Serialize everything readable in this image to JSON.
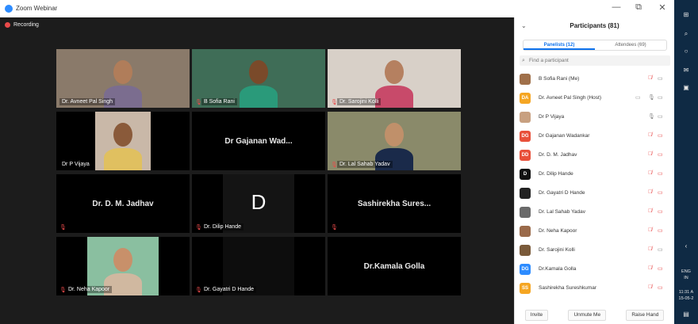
{
  "window": {
    "title": "Zoom Webinar",
    "min": "—",
    "restore": "⧉",
    "close": "✕"
  },
  "recording": {
    "label": "Recording"
  },
  "tiles": [
    {
      "kind": "video",
      "name": "Dr. Avneet Pal Singh",
      "muted": false,
      "active": true,
      "bg": "#8a7a6a",
      "skin": "#b07d5a",
      "shirt": "#7b6d8f"
    },
    {
      "kind": "video",
      "name": "B Sofia Rani",
      "muted": true,
      "active": false,
      "bg": "#3f6d57",
      "skin": "#7a4a2a",
      "shirt": "#2a9a7a"
    },
    {
      "kind": "video",
      "name": "Dr. Sarojini Kolli",
      "muted": true,
      "active": false,
      "bg": "#d8d0c8",
      "skin": "#b58060",
      "shirt": "#c84a6a"
    },
    {
      "kind": "video",
      "name": "Dr P Vijaya",
      "muted": false,
      "active": false,
      "bg": "#c9b8a8",
      "skin": "#8a5a3a",
      "shirt": "#e0c060"
    },
    {
      "kind": "text",
      "label": "Dr Gajanan Wad...",
      "muted": false
    },
    {
      "kind": "video",
      "name": "Dr. Lal Sahab Yadav",
      "muted": true,
      "active": false,
      "bg": "#8a8a6a",
      "skin": "#c0906a",
      "shirt": "#1a2a4a"
    },
    {
      "kind": "text",
      "label": "Dr. D. M. Jadhav",
      "muted": true
    },
    {
      "kind": "initial",
      "initial": "D",
      "name": "Dr. Dilip Hande",
      "muted": true
    },
    {
      "kind": "text",
      "label": "Sashirekha Sures...",
      "muted": true
    },
    {
      "kind": "video",
      "name": "Dr. Neha Kapoor",
      "muted": true,
      "active": false,
      "bg": "#8abfa0",
      "skin": "#c8906a",
      "shirt": "#d0b8a0"
    },
    {
      "kind": "dark",
      "name": "Dr. Gayatri D Hande",
      "muted": true
    },
    {
      "kind": "text",
      "label": "Dr.Kamala Golla",
      "muted": false
    }
  ],
  "panel": {
    "title": "Participants (81)",
    "collapse": "⌄",
    "tabs": [
      {
        "label": "Panelists (12)",
        "selected": true
      },
      {
        "label": "Attendees (69)",
        "selected": false
      }
    ],
    "search_placeholder": "Find a participant",
    "participants": [
      {
        "name": "B Sofia Rani (Me)",
        "avatar": "",
        "color": "#a0704a",
        "mic": "muted",
        "cam": "on"
      },
      {
        "name": "Dr. Avneet Pal Singh (Host)",
        "avatar": "DA",
        "color": "#f5a623",
        "mic": "on",
        "cam": "on",
        "sharing": true
      },
      {
        "name": "Dr P Vijaya",
        "avatar": "",
        "color": "#c8a080",
        "mic": "on",
        "cam": "on"
      },
      {
        "name": "Dr Gajanan Wadankar",
        "avatar": "DG",
        "color": "#e8503a",
        "mic": "muted",
        "cam": "off"
      },
      {
        "name": "Dr. D. M. Jadhav",
        "avatar": "DD",
        "color": "#e8503a",
        "mic": "muted",
        "cam": "off"
      },
      {
        "name": "Dr. Dilip Hande",
        "avatar": "D",
        "color": "#111111",
        "mic": "muted",
        "cam": "off"
      },
      {
        "name": "Dr. Gayatri D Hande",
        "avatar": "",
        "color": "#222222",
        "mic": "muted",
        "cam": "off"
      },
      {
        "name": "Dr. Lal Sahab Yadav",
        "avatar": "",
        "color": "#6a6a6a",
        "mic": "muted",
        "cam": "off"
      },
      {
        "name": "Dr. Neha Kapoor",
        "avatar": "",
        "color": "#9a6a4a",
        "mic": "muted",
        "cam": "off"
      },
      {
        "name": "Dr. Sarojini Kolli",
        "avatar": "",
        "color": "#7a5a3a",
        "mic": "muted",
        "cam": "on"
      },
      {
        "name": "Dr.Kamala Golla",
        "avatar": "DG",
        "color": "#2d8cff",
        "mic": "muted",
        "cam": "off"
      },
      {
        "name": "Sashirekha Sureshkumar",
        "avatar": "SS",
        "color": "#f5a623",
        "mic": "muted",
        "cam": "off"
      }
    ],
    "buttons": {
      "invite": "Invite",
      "unmute": "Unmute Me",
      "raise": "Raise Hand"
    }
  },
  "taskbar": {
    "lang1": "ENG",
    "lang2": "IN",
    "time": "11:31 A",
    "date": "15-05-2"
  }
}
